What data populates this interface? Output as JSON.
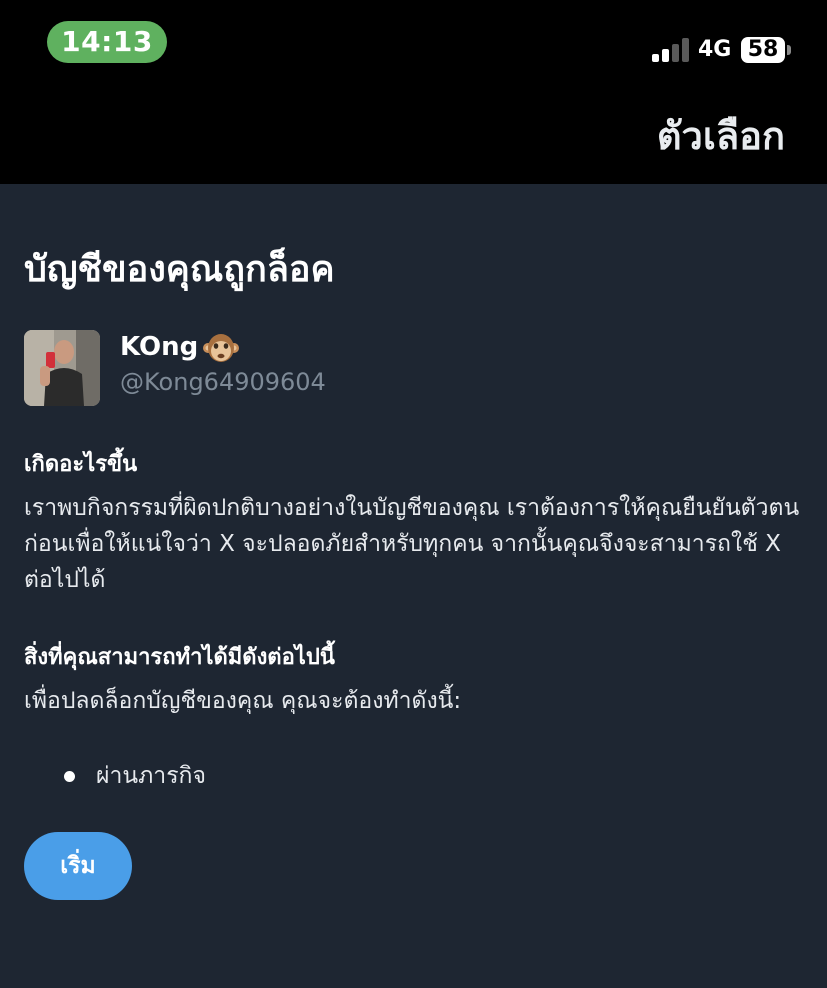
{
  "status_bar": {
    "time": "14:13",
    "network": "4G",
    "battery": "58",
    "time_pill_color": "#5fb15f",
    "signal_bars_active": 2,
    "signal_bars_total": 4
  },
  "nav": {
    "options_label": "ตัวเลือก"
  },
  "page": {
    "title": "บัญชีของคุณถูกล็อค"
  },
  "account": {
    "display_name": "KOng",
    "name_emoji_icon": "monkey-face-icon",
    "handle": "@Kong64909604"
  },
  "what_happened": {
    "heading": "เกิดอะไรขึ้น",
    "text": "เราพบกิจกรรมที่ผิดปกติบางอย่างในบัญชีของคุณ เราต้องการให้คุณยืนยันตัวตนก่อนเพื่อให้แน่ใจว่า X จะปลอดภัยสำหรับทุกคน จากนั้นคุณจึงจะสามารถใช้ X ต่อไปได้"
  },
  "what_you_can_do": {
    "heading": "สิ่งที่คุณสามารถทำได้มีดังต่อไปนี้",
    "text": "เพื่อปลดล็อกบัญชีของคุณ คุณจะต้องทำดังนี้:",
    "steps": [
      "ผ่านภารกิจ"
    ]
  },
  "actions": {
    "start_label": "เริ่ม",
    "start_color": "#4a9ee8"
  }
}
